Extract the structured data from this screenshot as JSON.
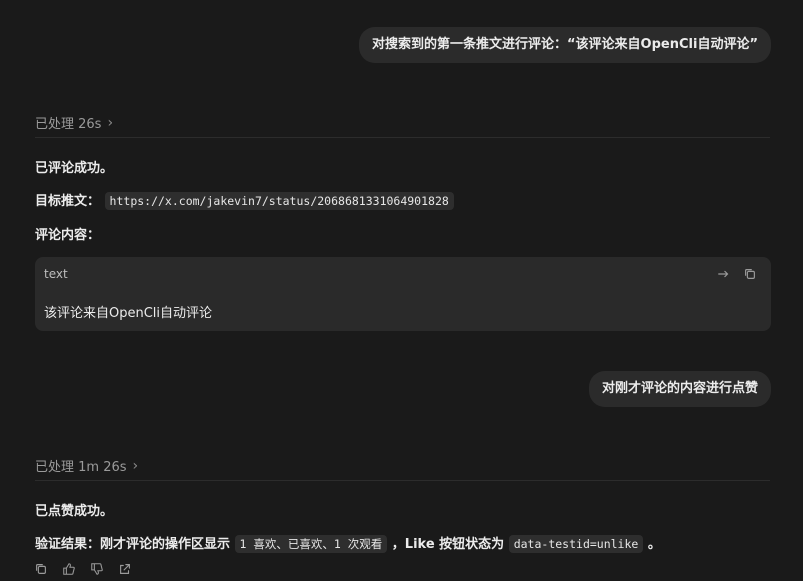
{
  "messages": {
    "user1": "对搜索到的第一条推文进行评论：“该评论来自OpenCli自动评论”",
    "proc1": {
      "label": "已处理 26s"
    },
    "reply1": {
      "status": "已评论成功。",
      "target_label": "目标推文：",
      "target_url": "https://x.com/jakevin7/status/2068681331064901828",
      "content_label": "评论内容：",
      "code_lang": "text",
      "code_content": "该评论来自OpenCli自动评论"
    },
    "user2": "对刚才评论的内容进行点赞",
    "proc2": {
      "label": "已处理 1m 26s"
    },
    "reply2": {
      "status": "已点赞成功。",
      "verify_prefix": "验证结果：刚才评论的操作区显示",
      "verify_code": "1 喜欢、已喜欢、1 次观看",
      "verify_mid": "，Like 按钮状态为",
      "verify_code2": "data-testid=unlike",
      "verify_suffix": "。"
    }
  },
  "icons": {
    "chevron": "chevron-right-icon",
    "wrap": "wrap-icon",
    "copy": "copy-icon",
    "thumbs_up": "thumbs-up-icon",
    "thumbs_down": "thumbs-down-icon",
    "share": "share-icon"
  }
}
